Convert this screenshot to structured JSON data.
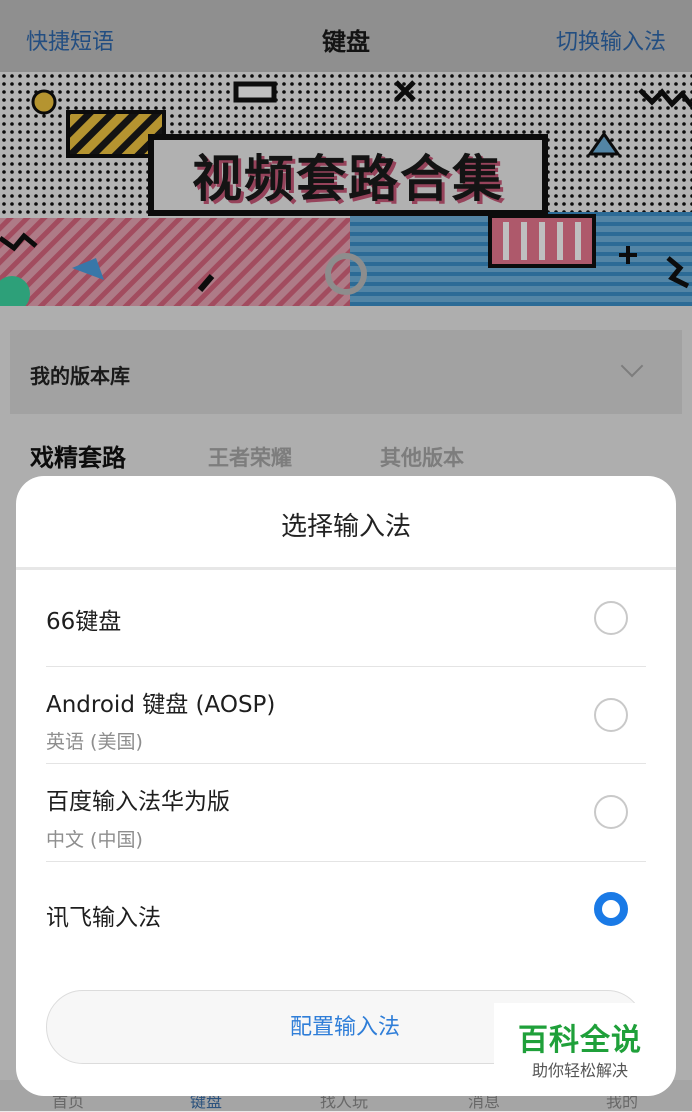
{
  "header": {
    "left_link": "快捷短语",
    "title": "键盘",
    "right_link": "切换输入法"
  },
  "banner": {
    "title": "视频套路合集"
  },
  "library": {
    "label": "我的版本库"
  },
  "category_tabs": [
    "戏精套路",
    "王者荣耀",
    "其他版本"
  ],
  "bottom_nav": [
    "首页",
    "键盘",
    "找人玩",
    "消息",
    "我的"
  ],
  "dialog": {
    "title": "选择输入法",
    "options": [
      {
        "name": "66键盘",
        "sub": "",
        "selected": false
      },
      {
        "name": "Android 键盘 (AOSP)",
        "sub": "英语 (美国)",
        "selected": false
      },
      {
        "name": "百度输入法华为版",
        "sub": "中文 (中国)",
        "selected": false
      },
      {
        "name": "讯飞输入法",
        "sub": "",
        "selected": true
      }
    ],
    "config_button": "配置输入法"
  },
  "watermark": {
    "line1": "百科全说",
    "line2": "助你轻松解决"
  },
  "colors": {
    "accent": "#1a7ae6",
    "link": "#2f69ad",
    "watermark_green": "#1fa03a"
  }
}
